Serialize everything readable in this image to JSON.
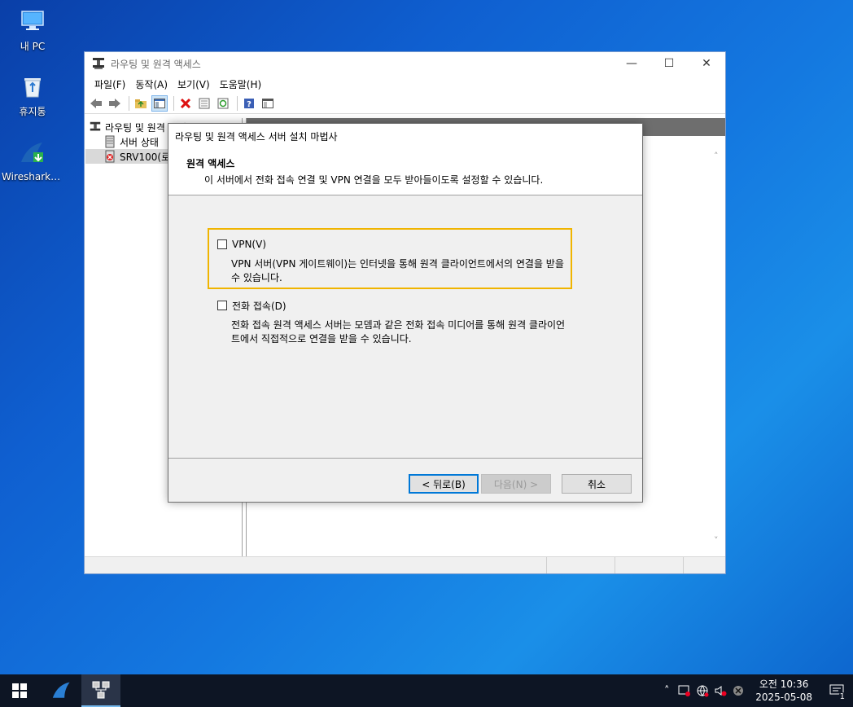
{
  "desktop": {
    "icons": [
      {
        "label": "내 PC",
        "icon": "computer-icon"
      },
      {
        "label": "휴지통",
        "icon": "recycle-bin-icon"
      },
      {
        "label": "Wireshark-4...",
        "icon": "wireshark-icon"
      }
    ]
  },
  "window": {
    "title": "라우팅 및 원격 액세스",
    "menu": [
      "파일(F)",
      "동작(A)",
      "보기(V)",
      "도움말(H)"
    ],
    "tree": {
      "root": "라우팅 및 원격 액세스",
      "items": [
        "서버 상태",
        "SRV100(로"
      ]
    }
  },
  "wizard": {
    "title": "라우팅 및 원격 액세스 서버 설치 마법사",
    "heading": "원격 액세스",
    "subheading": "이 서버에서 전화 접속 연결 및 VPN 연결을 모두 받아들이도록 설정할 수 있습니다.",
    "options": [
      {
        "label": "VPN(V)",
        "checked": false,
        "description": "VPN 서버(VPN 게이트웨이)는 인터넷을 통해 원격 클라이언트에서의 연결을 받을 수 있습니다."
      },
      {
        "label": "전화 접속(D)",
        "checked": false,
        "description": "전화 접속 원격 액세스 서버는 모뎀과 같은 전화 접속 미디어를 통해 원격 클라이언트에서 직접적으로 연결을 받을 수 있습니다."
      }
    ],
    "buttons": {
      "back": "< 뒤로(B)",
      "next": "다음(N) >",
      "cancel": "취소"
    },
    "highlight_color": "#f0b400"
  },
  "taskbar": {
    "time": "오전 10:36",
    "date": "2025-05-08",
    "notification_count": "1"
  }
}
